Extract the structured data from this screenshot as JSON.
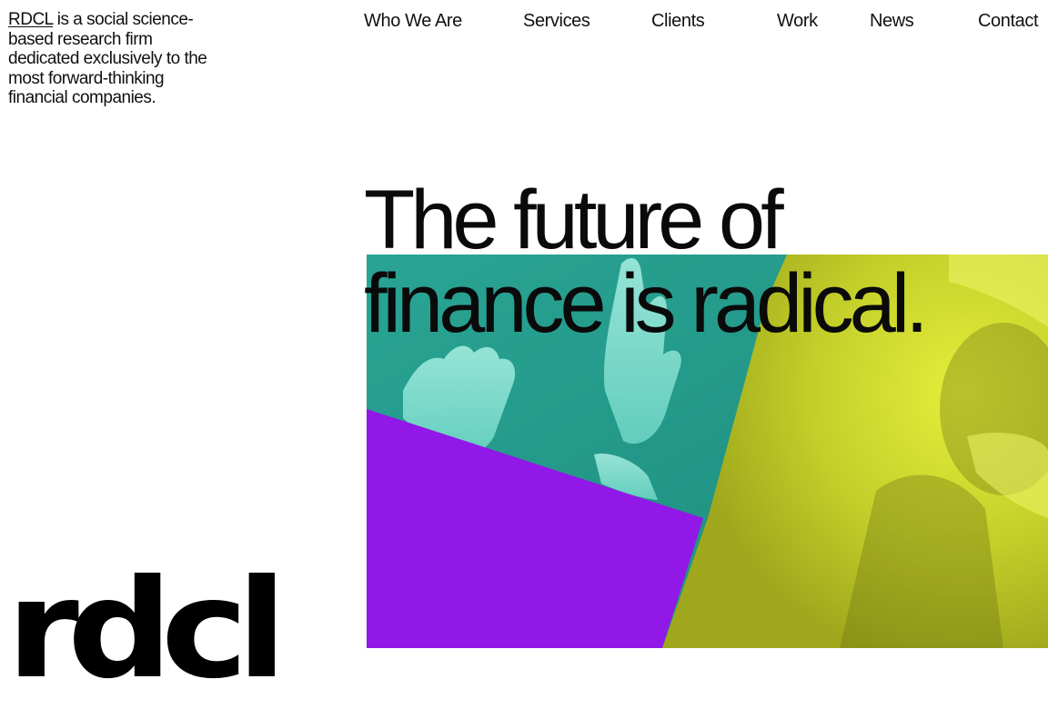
{
  "intro": {
    "link_text": "RDCL",
    "text": " is a social science-based research firm dedicated exclusively to the most forward-thinking financial companies."
  },
  "nav": {
    "items": [
      {
        "label": "Who We Are"
      },
      {
        "label": "Services"
      },
      {
        "label": "Clients"
      },
      {
        "label": "Work"
      },
      {
        "label": "News"
      },
      {
        "label": "Contact"
      }
    ]
  },
  "hero": {
    "headline_line1": "The future of",
    "headline_line2": "finance is radical."
  },
  "logo": {
    "text": "rdcl"
  },
  "colors": {
    "teal": "#23998a",
    "purple": "#9118e6",
    "lime": "#c6d22a",
    "text": "#111111"
  }
}
